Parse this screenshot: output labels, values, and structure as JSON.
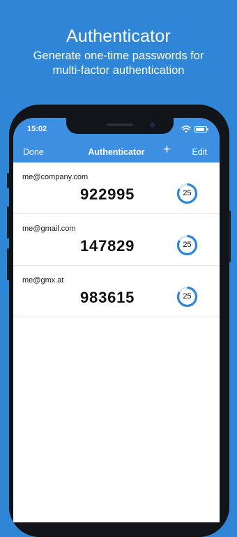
{
  "promo": {
    "title": "Authenticator",
    "subtitle_line1": "Generate one-time passwords for",
    "subtitle_line2": "multi-factor authentication"
  },
  "status_bar": {
    "time": "15:02",
    "icons": [
      "wifi-icon",
      "battery-icon"
    ]
  },
  "nav": {
    "done_label": "Done",
    "title": "Authenticator",
    "add_icon": "+",
    "edit_label": "Edit"
  },
  "accounts": [
    {
      "email": "me@company.com",
      "code": "922995",
      "seconds_left": "25"
    },
    {
      "email": "me@gmail.com",
      "code": "147829",
      "seconds_left": "25"
    },
    {
      "email": "me@gmx.at",
      "code": "983615",
      "seconds_left": "25"
    }
  ],
  "timer_progress_fraction": 0.83,
  "colors": {
    "background": "#2f86d6",
    "nav_bar": "#3c8fe1",
    "timer_ring": "#2f86d6",
    "timer_track": "#d6e7f8"
  }
}
